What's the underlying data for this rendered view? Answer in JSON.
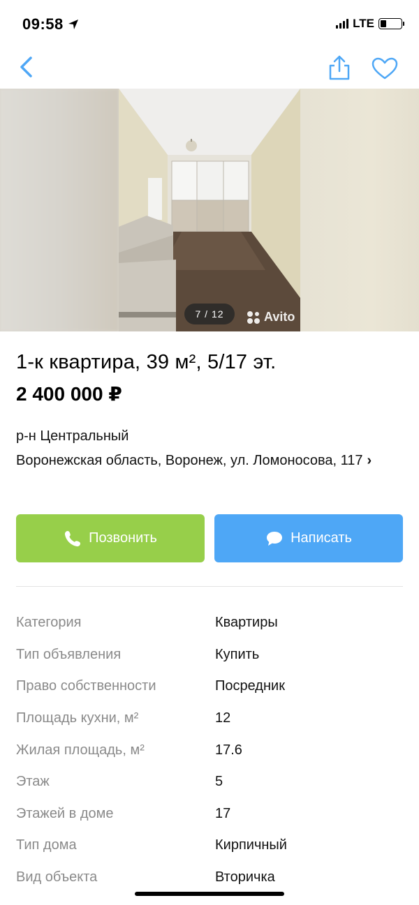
{
  "status_bar": {
    "time": "09:58",
    "network": "LTE",
    "battery_level": 0.3
  },
  "nav": {
    "back_icon": "chevron-left-icon",
    "share_icon": "share-icon",
    "favorite_icon": "heart-icon",
    "accent_color": "#4ea7f6"
  },
  "gallery": {
    "counter": "7 / 12",
    "watermark": "Avito"
  },
  "listing": {
    "title": "1-к квартира, 39 м², 5/17 эт.",
    "price": "2 400 000 ₽",
    "district": "р-н Центральный",
    "address": "Воронежская область, Воронеж, ул. Ломоносова, 117"
  },
  "actions": {
    "call_label": "Позвонить",
    "call_color": "#97cf4a",
    "write_label": "Написать",
    "write_color": "#4ea7f6"
  },
  "params": [
    {
      "label": "Категория",
      "value": "Квартиры"
    },
    {
      "label": "Тип объявления",
      "value": "Купить"
    },
    {
      "label": "Право собственности",
      "value": "Посредник"
    },
    {
      "label": "Площадь кухни, м²",
      "value": "12"
    },
    {
      "label": "Жилая площадь, м²",
      "value": "17.6"
    },
    {
      "label": "Этаж",
      "value": "5"
    },
    {
      "label": "Этажей в доме",
      "value": "17"
    },
    {
      "label": "Тип дома",
      "value": "Кирпичный"
    },
    {
      "label": "Вид объекта",
      "value": "Вторичка"
    }
  ]
}
